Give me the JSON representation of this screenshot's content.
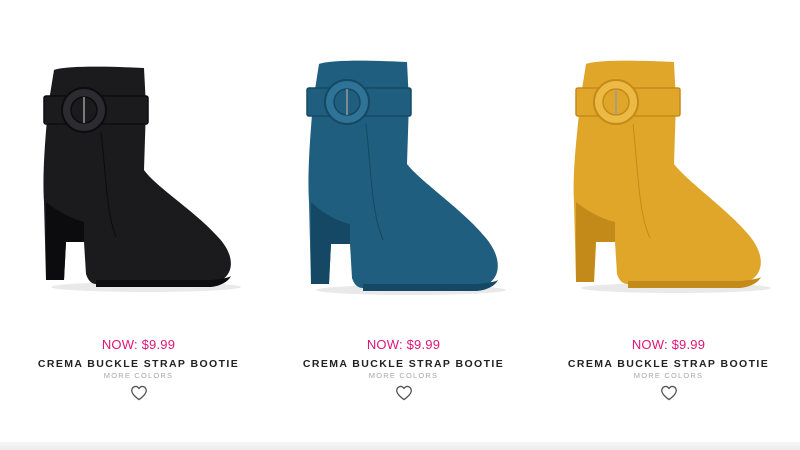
{
  "products": [
    {
      "price_label": "NOW: $9.99",
      "name": "CREMA BUCKLE STRAP BOOTIE",
      "more_colors": "MORE COLORS",
      "color": "#1b1b1d",
      "shade": "#0c0c0e",
      "highlight": "#2c2c30",
      "icon": "heart-outline-icon"
    },
    {
      "price_label": "NOW: $9.99",
      "name": "CREMA BUCKLE STRAP BOOTIE",
      "more_colors": "MORE COLORS",
      "color": "#1f5e7e",
      "shade": "#154864",
      "highlight": "#2f7396",
      "icon": "heart-outline-icon"
    },
    {
      "price_label": "NOW: $9.99",
      "name": "CREMA BUCKLE STRAP BOOTIE",
      "more_colors": "MORE COLORS",
      "color": "#e0a62a",
      "shade": "#c48a19",
      "highlight": "#edb945",
      "icon": "heart-outline-icon"
    }
  ],
  "colors": {
    "price": "#e0157a",
    "name": "#222222",
    "muted": "#a8a8a8"
  }
}
